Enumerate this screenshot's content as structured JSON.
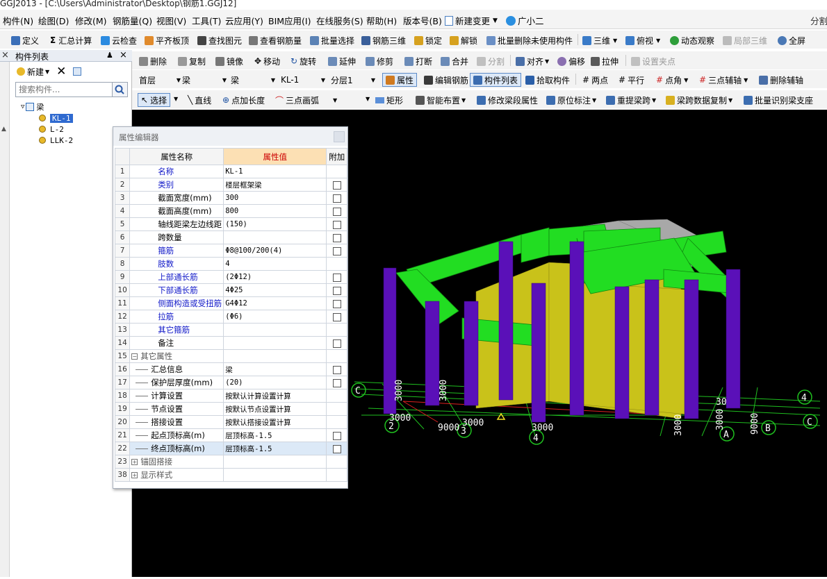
{
  "window": {
    "title": "GGJ2013 - [C:\\Users\\Administrator\\Desktop\\钢筋1.GGJ12]"
  },
  "menu": [
    "构件(N)",
    "绘图(D)",
    "修改(M)",
    "钢筋量(Q)",
    "视图(V)",
    "工具(T)",
    "云应用(Y)",
    "BIM应用(I)",
    "在线服务(S)",
    "帮助(H)",
    "版本号(B)",
    "新建变更",
    "广小二"
  ],
  "menu_right": "分割",
  "toolbar1": [
    "定义",
    "汇总计算",
    "云检查",
    "平齐板顶",
    "查找图元",
    "查看钢筋量",
    "批量选择",
    "钢筋三维",
    "锁定",
    "解锁",
    "批量删除未使用构件",
    "三维",
    "俯视",
    "动态观察",
    "局部三维",
    "全屏"
  ],
  "toolbar2": [
    "删除",
    "复制",
    "镜像",
    "移动",
    "旋转",
    "延伸",
    "修剪",
    "打断",
    "合并",
    "分割",
    "对齐",
    "偏移",
    "拉伸",
    "设置夹点"
  ],
  "toolbar3": {
    "floor": "首层",
    "type1": "梁",
    "type2": "梁",
    "member": "KL-1",
    "layer": "分层1",
    "buttons": [
      "属性",
      "编辑钢筋",
      "构件列表",
      "拾取构件",
      "两点",
      "平行",
      "点角",
      "三点辅轴",
      "删除辅轴"
    ]
  },
  "toolbar4": [
    "选择",
    "直线",
    "点加长度",
    "三点画弧",
    "矩形",
    "智能布置",
    "修改梁段属性",
    "原位标注",
    "重提梁跨",
    "梁跨数据复制",
    "批量识别梁支座"
  ],
  "left_panel": {
    "title": "构件列表",
    "new_label": "新建",
    "search_placeholder": "搜索构件...",
    "tree": {
      "root": "梁",
      "items": [
        "KL-1",
        "L-2",
        "LLK-2"
      ],
      "selected_index": 0
    }
  },
  "property_editor": {
    "title": "属性编辑器",
    "headers": [
      "属性名称",
      "属性值",
      "附加"
    ],
    "rows": [
      {
        "n": "1",
        "name": "名称",
        "value": "KL-1",
        "cb": false,
        "style": "blue"
      },
      {
        "n": "2",
        "name": "类别",
        "value": "楼层框架梁",
        "cb": true,
        "style": "blue"
      },
      {
        "n": "3",
        "name": "截面宽度(mm)",
        "value": "300",
        "cb": true,
        "style": "black"
      },
      {
        "n": "4",
        "name": "截面高度(mm)",
        "value": "800",
        "cb": true,
        "style": "black"
      },
      {
        "n": "5",
        "name": "轴线距梁左边线距",
        "value": "(150)",
        "cb": true,
        "style": "black"
      },
      {
        "n": "6",
        "name": "跨数量",
        "value": "",
        "cb": true,
        "style": "black"
      },
      {
        "n": "7",
        "name": "箍筋",
        "value": "Φ8@100/200(4)",
        "cb": true,
        "style": "blue"
      },
      {
        "n": "8",
        "name": "肢数",
        "value": "4",
        "cb": false,
        "style": "blue"
      },
      {
        "n": "9",
        "name": "上部通长筋",
        "value": "(2Φ12)",
        "cb": true,
        "style": "blue"
      },
      {
        "n": "10",
        "name": "下部通长筋",
        "value": "4Φ25",
        "cb": true,
        "style": "blue"
      },
      {
        "n": "11",
        "name": "侧面构造或受扭筋",
        "value": "G4Φ12",
        "cb": true,
        "style": "blue"
      },
      {
        "n": "12",
        "name": "拉筋",
        "value": "(Φ6)",
        "cb": true,
        "style": "blue"
      },
      {
        "n": "13",
        "name": "其它箍筋",
        "value": "",
        "cb": false,
        "style": "blue"
      },
      {
        "n": "14",
        "name": "备注",
        "value": "",
        "cb": true,
        "style": "black"
      },
      {
        "n": "15",
        "name": "其它属性",
        "value": "",
        "cb": false,
        "style": "group",
        "expander": "−"
      },
      {
        "n": "16",
        "name": "汇总信息",
        "value": "梁",
        "cb": true,
        "style": "sub"
      },
      {
        "n": "17",
        "name": "保护层厚度(mm)",
        "value": "(20)",
        "cb": true,
        "style": "sub"
      },
      {
        "n": "18",
        "name": "计算设置",
        "value": "按默认计算设置计算",
        "cb": false,
        "style": "sub"
      },
      {
        "n": "19",
        "name": "节点设置",
        "value": "按默认节点设置计算",
        "cb": false,
        "style": "sub"
      },
      {
        "n": "20",
        "name": "搭接设置",
        "value": "按默认搭接设置计算",
        "cb": false,
        "style": "sub"
      },
      {
        "n": "21",
        "name": "起点顶标高(m)",
        "value": "层顶标高-1.5",
        "cb": true,
        "style": "sub"
      },
      {
        "n": "22",
        "name": "终点顶标高(m)",
        "value": "层顶标高-1.5",
        "cb": true,
        "style": "sub",
        "selected": true
      },
      {
        "n": "23",
        "name": "锚固搭接",
        "value": "",
        "cb": false,
        "style": "group",
        "expander": "+"
      },
      {
        "n": "38",
        "name": "显示样式",
        "value": "",
        "cb": false,
        "style": "group",
        "expander": "+"
      }
    ]
  },
  "scene": {
    "axis_labels": [
      "C",
      "A",
      "B",
      "C",
      "2",
      "3",
      "4",
      "4"
    ],
    "dims": [
      "3000",
      "3000",
      "3000",
      "3000",
      "3000",
      "3000",
      "9000",
      "9000",
      "3000",
      "30"
    ],
    "colors": {
      "beam": "#22dd22",
      "column": "#5a10b8",
      "wall": "#c9c21a",
      "slab": "#a8a8a8",
      "grid": "#1fbf1f",
      "grid_red": "#e02020"
    }
  }
}
